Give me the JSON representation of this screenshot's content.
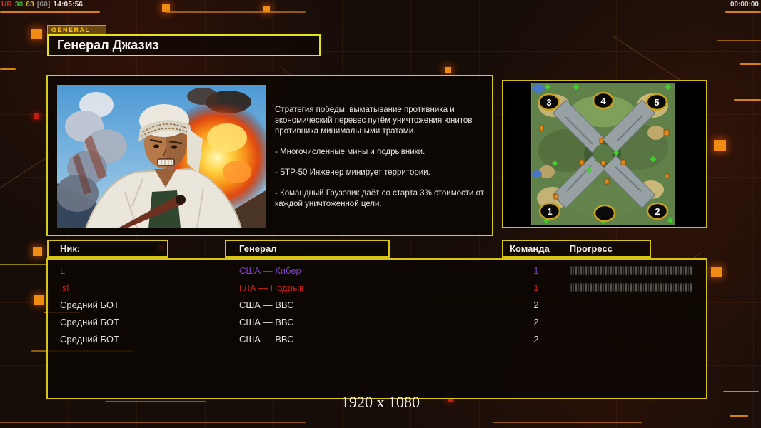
{
  "hud": {
    "debug_segments": [
      {
        "text": "UR",
        "color": "#c23320"
      },
      {
        "text": "30",
        "color": "#2fb42f"
      },
      {
        "text": "63",
        "color": "#d8b520"
      },
      {
        "text": "[60]",
        "color": "#8a8a88"
      },
      {
        "text": "14:05:56",
        "color": "#e8e6e2"
      }
    ],
    "timer": "00:00:00"
  },
  "header": {
    "tab_label": "GENERAL",
    "title": "Генерал Джазиз"
  },
  "info_panel": {
    "strategy_paragraphs": [
      "Стратегия победы: выматывание противника и экономический перевес путём уничтожения юнитов противника минимальными тратами.",
      "- Многочисленные мины и подрывники.",
      "- БТР-50 Инженер минирует территории.",
      "- Командный Грузовик даёт со старта 3% стоимости от каждой уничтоженной цели."
    ]
  },
  "minimap": {
    "start_positions": [
      "3",
      "4",
      "5",
      "1",
      "",
      "2"
    ]
  },
  "table": {
    "headers": {
      "nick": "Ник:",
      "general": "Генерал",
      "team": "Команда",
      "progress": "Прогресс"
    },
    "rows": [
      {
        "nick": "L",
        "general": "США — Кибер",
        "team": "1",
        "color": "#7d3fc8",
        "has_progress": true
      },
      {
        "nick": "isl",
        "general": "ГЛА — Подрыв",
        "team": "1",
        "color": "#c82418",
        "has_progress": true
      },
      {
        "nick": "Средний БОТ",
        "general": "США — ВВС",
        "team": "2",
        "color": "#e2dfdb",
        "has_progress": false
      },
      {
        "nick": "Средний БОТ",
        "general": "США — ВВС",
        "team": "2",
        "color": "#e2dfdb",
        "has_progress": false
      },
      {
        "nick": "Средний БОТ",
        "general": "США — ВВС",
        "team": "2",
        "color": "#e2dfdb",
        "has_progress": false
      }
    ]
  },
  "footer": {
    "resolution": "1920 x 1080"
  },
  "colors": {
    "panel_border": "#d6cd15",
    "accent_orange": "#f08c14",
    "accent_red": "#c41e12"
  }
}
